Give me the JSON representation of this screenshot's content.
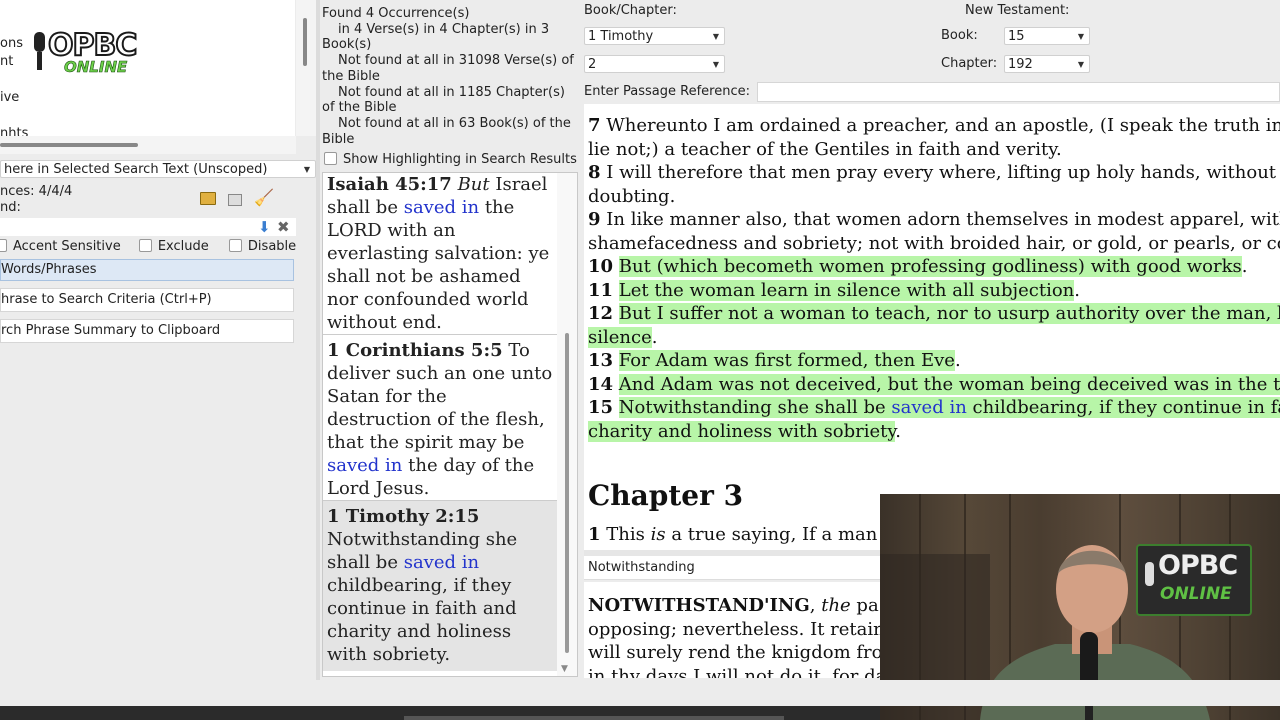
{
  "logo": {
    "top": "OPBC",
    "bottom": "ONLINE"
  },
  "left_panel": {
    "cut_items": [
      "ons",
      "nt",
      "ive",
      "nhts"
    ],
    "scope_dropdown": "here in Selected Search Text (Unscoped)",
    "matches_label": "nces: 4/4/4",
    "found_label": "nd:",
    "options": {
      "accent": "Accent Sensitive",
      "exclude": "Exclude",
      "disable": "Disable"
    },
    "words_phrases": "Words/Phrases",
    "add_phrase": "hrase to Search Criteria (Ctrl+P)",
    "copy_summary": "rch Phrase Summary to Clipboard"
  },
  "summary": {
    "line1": "Found 4 Occurrence(s)",
    "line2": "in 4 Verse(s) in 4 Chapter(s) in 3",
    "line3": "Book(s)",
    "line4": "Not found at all in 31098 Verse(s) of",
    "line5": "the Bible",
    "line6": "Not found at all in 1185 Chapter(s)",
    "line7": "of the Bible",
    "line8": "Not found at all in 63 Book(s) of the",
    "line9": "Bible",
    "highlight_label": "Show Highlighting in Search Results"
  },
  "results": [
    {
      "ref": "Isaiah 45:17",
      "lines": [
        "<i>But</i> Israel",
        "shall be <span class='blue'>saved in</span> the",
        "LORD with an",
        "everlasting salvation: ye",
        "shall not be ashamed",
        "nor confounded world",
        "without end."
      ]
    },
    {
      "ref": "1 Corinthians 5:5",
      "lines": [
        "To",
        "deliver such an one unto",
        "Satan for the",
        "destruction of the flesh,",
        "that the spirit may be",
        "<span class='blue'>saved in</span> the day of the",
        "Lord Jesus."
      ]
    },
    {
      "ref": "1 Timothy 2:15",
      "lines": [
        "Notwithstanding she",
        "shall be <span class='blue'>saved in</span>",
        "childbearing, if they",
        "continue in faith and",
        "charity and holiness",
        "with sobriety."
      ]
    }
  ],
  "nav": {
    "book_chapter_label": "Book/Chapter:",
    "book": "1 Timothy",
    "chapter": "2",
    "passage_label": "Enter Passage Reference:",
    "passage_value": "",
    "nt_label": "New Testament:",
    "book_num_label": "Book:",
    "book_num": "15",
    "chapter_num_label": "Chapter:",
    "chapter_num": "192"
  },
  "bible": {
    "lines": [
      {
        "n": "7",
        "t": "Whereunto I am ordained a preacher, and an apostle, (I speak the truth in",
        "hl": false
      },
      {
        "n": "",
        "t": "lie not;) a teacher of the Gentiles in faith and verity.",
        "hl": false
      },
      {
        "n": "8",
        "t": "I will therefore that men pray every where, lifting up holy hands, without",
        "hl": false
      },
      {
        "n": "",
        "t": "doubting.",
        "hl": false
      },
      {
        "n": "9",
        "t": "In like manner also, that women adorn themselves in modest apparel, with",
        "hl": false
      },
      {
        "n": "",
        "t": "shamefacedness and sobriety; not with broided hair, or gold, or pearls, or co",
        "hl": false
      },
      {
        "n": "10",
        "t": "But (which becometh women professing godliness) with good works",
        "hl": true,
        "tail": "."
      },
      {
        "n": "11",
        "t": "Let the woman learn in silence with all subjection",
        "hl": true,
        "tail": "."
      },
      {
        "n": "12",
        "t": "But I suffer not a woman to teach, nor to usurp authority over the man, b",
        "hl": true
      },
      {
        "n": "",
        "t": "silence",
        "hl": true,
        "tail": "."
      },
      {
        "n": "13",
        "t": "For Adam was first formed, then Eve",
        "hl": true,
        "tail": "."
      },
      {
        "n": "14",
        "t": "And Adam was not deceived, but the woman being deceived was in the t",
        "hl": true
      },
      {
        "n": "15",
        "t": "Notwithstanding she shall be <span class='blue'>saved in</span> childbearing, if they continue in fa",
        "hl": true
      },
      {
        "n": "",
        "t": "charity and holiness with sobriety",
        "hl": true,
        "tail": "."
      }
    ],
    "chapter_heading": "Chapter 3",
    "ch3_verse_num": "1",
    "ch3_verse_text": "This <i>is</i> a true saying, If a man"
  },
  "dictionary": {
    "word": "Notwithstanding",
    "headword": "NOTWITHSTAND'ING",
    "lines": [
      "<b>NOTWITHSTAND'ING</b>, <i>the</i> pa",
      "opposing; nevertheless. It retain",
      "will surely rend the knigdom fro",
      "in thy days I will not do it, for da"
    ]
  },
  "video_overlay": {
    "logo_top": "OPBC",
    "logo_bottom": "ONLINE"
  }
}
